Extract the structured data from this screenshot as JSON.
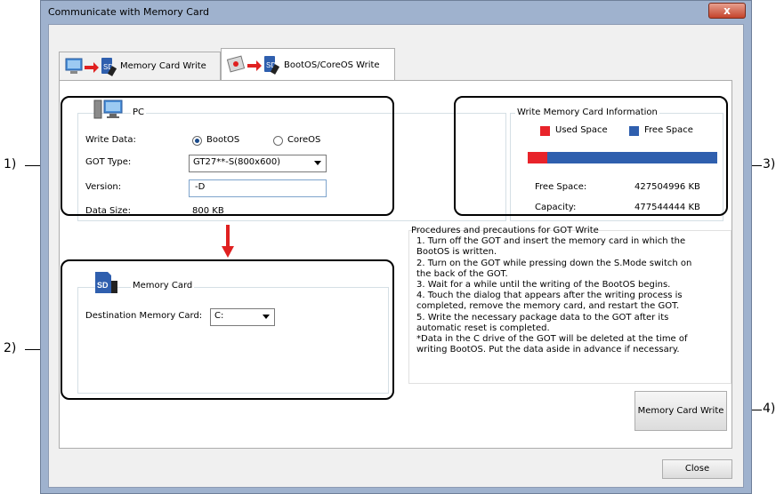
{
  "window": {
    "title": "Communicate with Memory Card",
    "close_glyph": "x"
  },
  "tabs": [
    {
      "label": "Memory Card Write",
      "icon": "pc-to-sd-icon"
    },
    {
      "label": "BootOS/CoreOS Write",
      "icon": "got-to-sd-icon"
    }
  ],
  "pc_group": {
    "title": "PC",
    "write_data_label": "Write Data:",
    "write_data_options": [
      "BootOS",
      "CoreOS"
    ],
    "write_data_selected": "BootOS",
    "got_type_label": "GOT Type:",
    "got_type_value": "GT27**-S(800x600)",
    "version_label": "Version:",
    "version_value": "-D",
    "data_size_label": "Data Size:",
    "data_size_value": "800 KB"
  },
  "memory_card_group": {
    "title": "Memory Card",
    "destination_label": "Destination Memory Card:",
    "destination_value": "C:"
  },
  "card_info": {
    "title": "Write Memory Card Information",
    "used_label": "Used Space",
    "free_label": "Free Space",
    "used_color": "#e8232a",
    "free_color": "#2f5fae",
    "used_fraction": 0.105,
    "free_space_label": "Free Space:",
    "free_space_value": "427504996 KB",
    "capacity_label": "Capacity:",
    "capacity_value": "477544444 KB"
  },
  "procedures": {
    "title": "Procedures and precautions for GOT Write",
    "lines": [
      "1. Turn off the GOT and insert the memory card in which the",
      "BootOS is written.",
      "2. Turn on the GOT while pressing down the S.Mode switch on",
      "the back of the GOT.",
      "3. Wait for a while until the writing of the BootOS begins.",
      "4. Touch the dialog that appears after the writing process is",
      "completed, remove the memory card, and restart the GOT.",
      "5. Write the necessary package data to the GOT after its",
      "automatic reset is completed.",
      "*Data in the C drive of the GOT will be deleted at the time of",
      "writing BootOS. Put the data aside in advance if necessary."
    ]
  },
  "buttons": {
    "write": "Memory Card Write",
    "close": "Close"
  },
  "callouts": [
    "1)",
    "2)",
    "3)",
    "4)"
  ],
  "flow_arrow_color": "#e02020"
}
